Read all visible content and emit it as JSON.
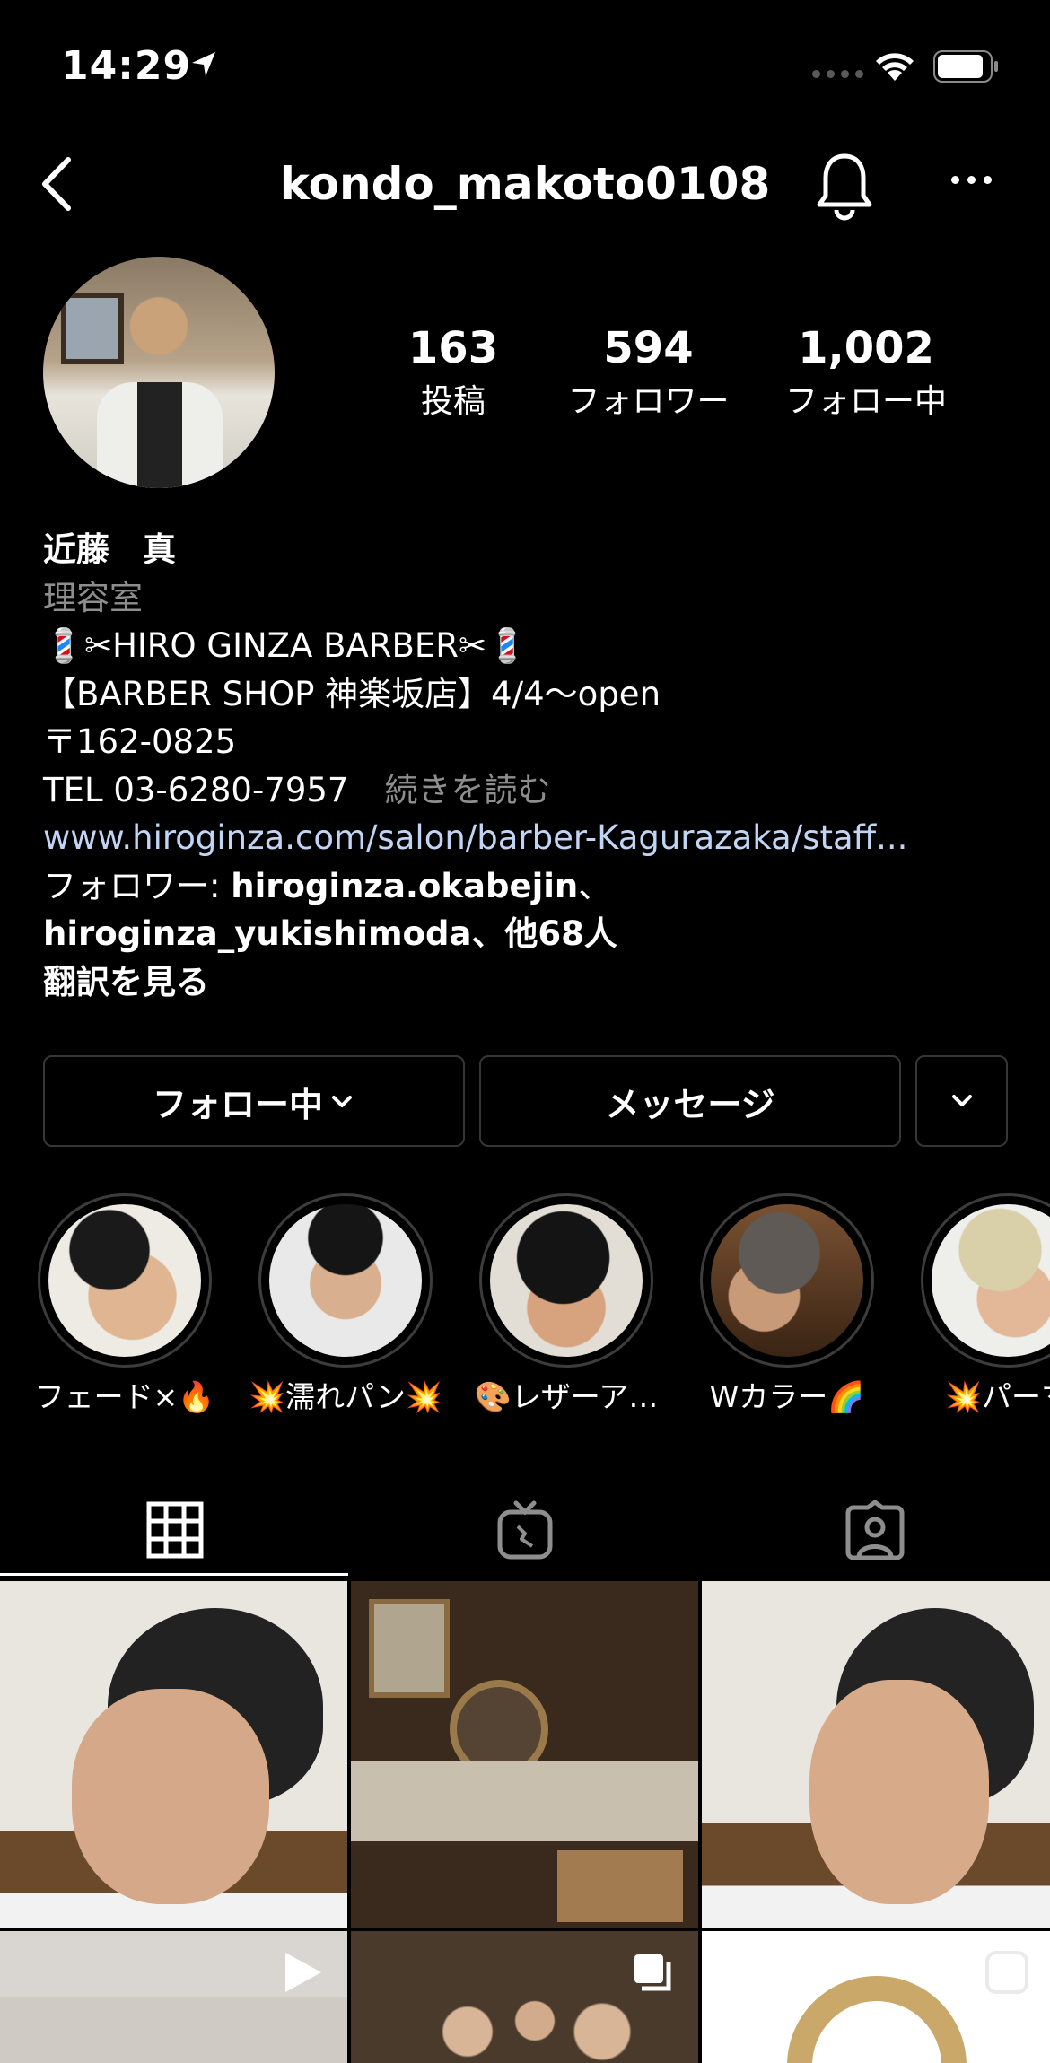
{
  "status_bar": {
    "time": "14:29"
  },
  "nav": {
    "username": "kondo_makoto0108"
  },
  "profile": {
    "stats": [
      {
        "num": "163",
        "label": "投稿"
      },
      {
        "num": "594",
        "label": "フォロワー"
      },
      {
        "num": "1,002",
        "label": "フォロー中"
      }
    ],
    "name": "近藤　真",
    "category": "理容室",
    "bio_lines": [
      "💈✂︎HIRO GINZA BARBER✂︎💈",
      "【BARBER SHOP 神楽坂店】4/4〜open",
      "〒162-0825",
      "TEL 03-6280-7957"
    ],
    "more_label": "続きを読む",
    "link": "www.hiroginza.com/salon/barber-Kagurazaka/staff...",
    "followed_by_prefix": "フォロワー: ",
    "followed_by_user1": "hiroginza.okabejin",
    "followed_by_sep": "、",
    "followed_by_user2": "hiroginza_yukishimoda",
    "followed_by_suffix": "、他68人",
    "translate_label": "翻訳を見る"
  },
  "buttons": {
    "following": "フォロー中",
    "message": "メッセージ"
  },
  "highlights": [
    {
      "caption": "フェード×🔥"
    },
    {
      "caption": "💥濡れパン💥"
    },
    {
      "caption": "🎨レザーア…"
    },
    {
      "caption": "Wカラー🌈"
    },
    {
      "caption": "💥パーマ"
    }
  ]
}
